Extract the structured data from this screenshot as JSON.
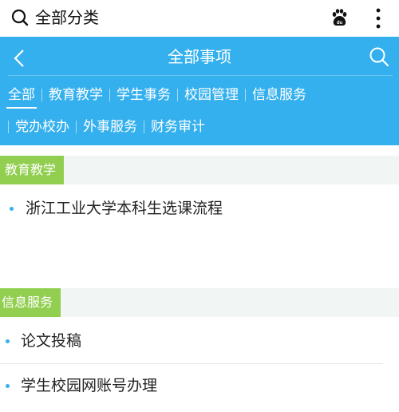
{
  "topbar": {
    "title": "全部分类"
  },
  "header": {
    "title": "全部事项"
  },
  "tabs": [
    "全部",
    "教育教学",
    "学生事务",
    "校园管理",
    "信息服务",
    "党办校办",
    "外事服务",
    "财务审计"
  ],
  "active_tab": "全部",
  "sections": [
    {
      "title": "教育教学",
      "items": [
        "浙江工业大学本科生选课流程"
      ]
    },
    {
      "title": "信息服务",
      "items": [
        "论文投稿",
        "学生校园网账号办理"
      ]
    }
  ],
  "colors": {
    "header": "#35b0ee",
    "section_label": "#92cf50",
    "section_bg": "#f1f6f5",
    "bullet": "#35b0ee"
  }
}
